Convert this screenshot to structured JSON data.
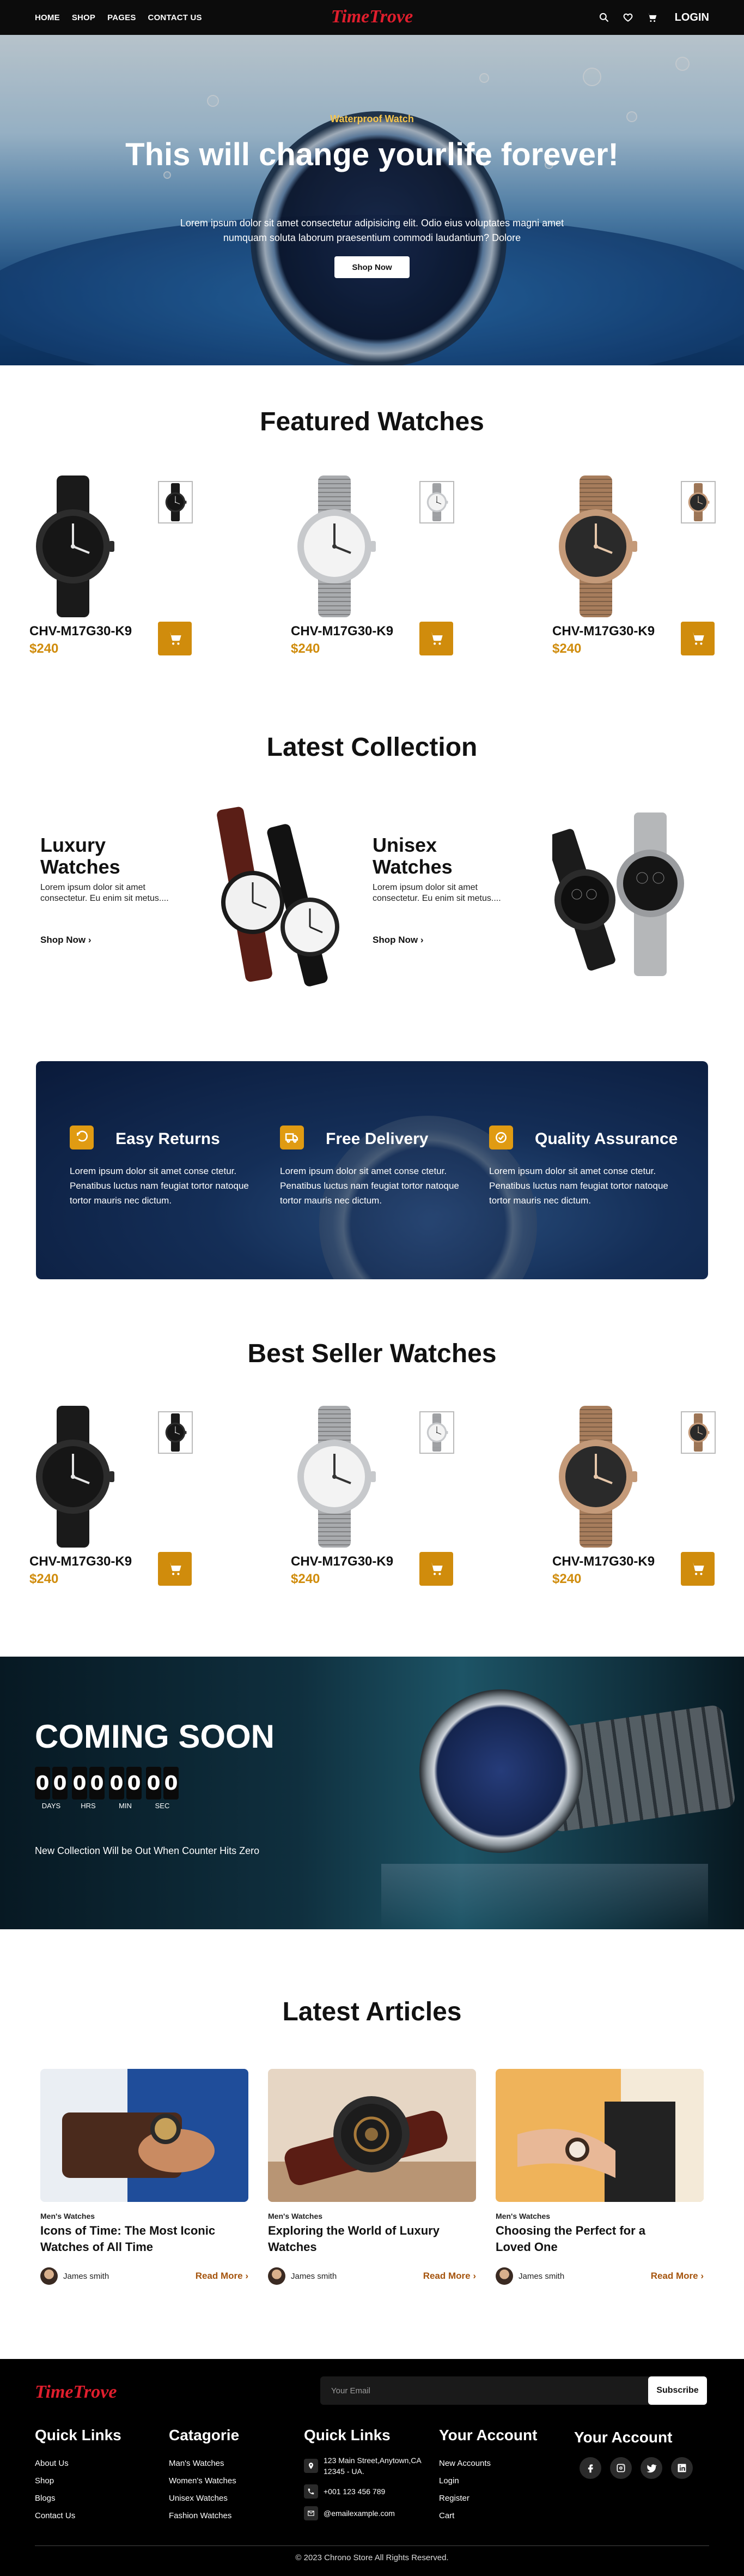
{
  "nav": {
    "links": [
      "HOME",
      "SHOP",
      "PAGES",
      "CONTACT US"
    ],
    "logo": "TimeTrove",
    "icons": [
      "search-icon",
      "heart-icon",
      "cart-icon"
    ],
    "login": "LOGIN"
  },
  "hero": {
    "subtitle": "Waterproof Watch",
    "title": "This will change yourlife forever!",
    "body": "Lorem ipsum dolor sit amet consectetur adipisicing elit. Odio eius voluptates magni amet numquam soluta laborum praesentium commodi laudantium? Dolore",
    "button": "Shop Now"
  },
  "featured": {
    "title": "Featured Watches",
    "products": [
      {
        "name": "CHV-M17G30-K9",
        "price": "$240",
        "style": "black"
      },
      {
        "name": "CHV-M17G30-K9",
        "price": "$240",
        "style": "silver"
      },
      {
        "name": "CHV-M17G30-K9",
        "price": "$240",
        "style": "rose"
      }
    ]
  },
  "collection": {
    "title": "Latest Collection",
    "items": [
      {
        "title": "Luxury Watches",
        "desc": "Lorem ipsum dolor sit amet consectetur. Eu enim sit metus....",
        "link": "Shop Now"
      },
      {
        "title": "Unisex Watches",
        "desc": "Lorem ipsum dolor sit amet consectetur. Eu enim sit metus....",
        "link": "Shop Now"
      }
    ]
  },
  "features": [
    {
      "title": "Easy Returns",
      "icon": "return-icon",
      "desc": "Lorem ipsum dolor sit amet conse ctetur. Penatibus luctus nam feugiat tortor natoque tortor mauris nec dictum."
    },
    {
      "title": "Free Delivery",
      "icon": "truck-icon",
      "desc": "Lorem ipsum dolor sit amet conse ctetur. Penatibus luctus nam feugiat tortor natoque tortor mauris nec dictum."
    },
    {
      "title": "Quality Assurance",
      "icon": "badge-check-icon",
      "desc": "Lorem ipsum dolor sit amet conse ctetur. Penatibus luctus nam feugiat tortor natoque tortor mauris nec dictum."
    }
  ],
  "bestseller": {
    "title": "Best Seller Watches",
    "products": [
      {
        "name": "CHV-M17G30-K9",
        "price": "$240",
        "style": "black"
      },
      {
        "name": "CHV-M17G30-K9",
        "price": "$240",
        "style": "silver"
      },
      {
        "name": "CHV-M17G30-K9",
        "price": "$240",
        "style": "rose"
      }
    ]
  },
  "coming": {
    "title": "COMING SOON",
    "units": [
      {
        "digits": "00",
        "label": "DAYS"
      },
      {
        "digits": "00",
        "label": "HRS"
      },
      {
        "digits": "00",
        "label": "MIN"
      },
      {
        "digits": "00",
        "label": "SEC"
      }
    ],
    "note": "New Collection Will be Out When Counter Hits Zero"
  },
  "articles": {
    "title": "Latest Articles",
    "items": [
      {
        "category": "Men's Watches",
        "title": "Icons of Time: The Most Iconic Watches of All Time",
        "author": "James smith",
        "more": "Read More"
      },
      {
        "category": "Men's Watches",
        "title": "Exploring the World of Luxury Watches",
        "author": "James smith",
        "more": "Read More"
      },
      {
        "category": "Men's Watches",
        "title": "Choosing the Perfect for a Loved One",
        "author": "James smith",
        "more": "Read More"
      }
    ]
  },
  "footer": {
    "logo": "TimeTrove",
    "email_placeholder": "Your Email",
    "subscribe": "Subscribe",
    "col1": {
      "title": "Quick Links",
      "items": [
        "About Us",
        "Shop",
        "Blogs",
        "Contact Us"
      ]
    },
    "col2": {
      "title": "Catagorie",
      "items": [
        "Man's Watches",
        "Women's Watches",
        "Unisex Watches",
        "Fashion Watches"
      ]
    },
    "col3": {
      "title": "Quick Links",
      "address": "123 Main Street,Anytown,CA 12345 - UA.",
      "phone": "+001 123 456 789",
      "email": "@emailexample.com"
    },
    "col4": {
      "title": "Your Account",
      "items": [
        "New Accounts",
        "Login",
        "Register",
        "Cart"
      ]
    },
    "col5": {
      "title": "Your Account",
      "socials": [
        "facebook-icon",
        "instagram-icon",
        "twitter-icon",
        "linkedin-icon"
      ]
    },
    "copyright": "© 2023 Chrono Store All Rights Reserved."
  },
  "colors": {
    "accent": "#d08c0c",
    "brand": "#e01e2d",
    "dark": "#0c0c0c"
  }
}
